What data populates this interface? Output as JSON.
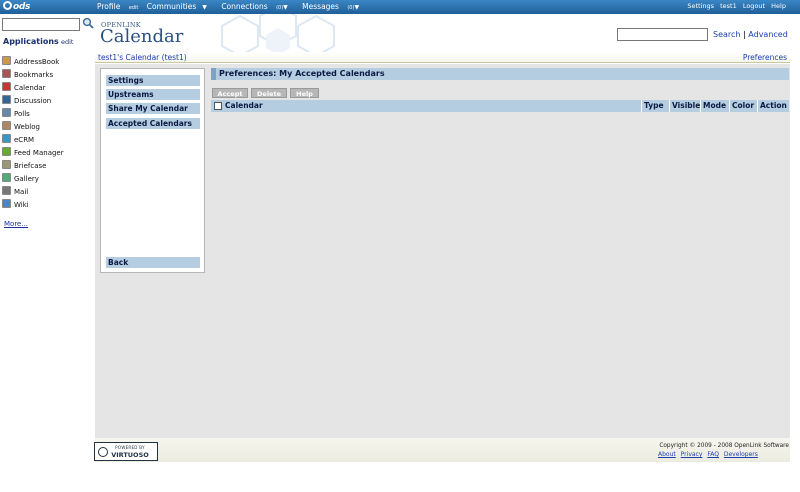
{
  "topbar": {
    "logo": "ods",
    "nav": {
      "profile": "Profile",
      "profile_edit": "edit",
      "communities": "Communities",
      "connections": "Connections",
      "connections_count": "(0)",
      "messages": "Messages",
      "messages_count": "(0)"
    },
    "right": {
      "settings": "Settings",
      "user": "test1",
      "logout": "Logout",
      "help": "Help"
    }
  },
  "left": {
    "apps_title": "Applications",
    "apps_edit": "edit",
    "apps": [
      {
        "label": "AddressBook",
        "icon": "addressbook-icon"
      },
      {
        "label": "Bookmarks",
        "icon": "bookmarks-icon"
      },
      {
        "label": "Calendar",
        "icon": "calendar-icon"
      },
      {
        "label": "Discussion",
        "icon": "discussion-icon"
      },
      {
        "label": "Polls",
        "icon": "polls-icon"
      },
      {
        "label": "Weblog",
        "icon": "weblog-icon"
      },
      {
        "label": "eCRM",
        "icon": "ecrm-icon"
      },
      {
        "label": "Feed Manager",
        "icon": "feed-icon"
      },
      {
        "label": "Briefcase",
        "icon": "briefcase-icon"
      },
      {
        "label": "Gallery",
        "icon": "gallery-icon"
      },
      {
        "label": "Mail",
        "icon": "mail-icon"
      },
      {
        "label": "Wiki",
        "icon": "wiki-icon"
      }
    ],
    "more": "More..."
  },
  "header": {
    "brand_small": "OPENLINK",
    "brand_big": "Calendar",
    "search": "Search",
    "sep": "|",
    "advanced": "Advanced"
  },
  "crumb": {
    "title": "test1's Calendar (test1)",
    "preferences": "Preferences"
  },
  "menu": {
    "items": [
      "Settings",
      "Upstreams",
      "Share My Calendar",
      "Accepted Calendars"
    ],
    "back": "Back"
  },
  "content": {
    "title": "Preferences: My Accepted Calendars",
    "buttons": {
      "accept": "Accept",
      "delete": "Delete",
      "help": "Help"
    },
    "columns": {
      "calendar": "Calendar",
      "type": "Type",
      "visible": "Visible",
      "mode": "Mode",
      "color": "Color",
      "action": "Action"
    }
  },
  "footer": {
    "badge_top": "POWERED BY",
    "badge_main": "VIRTUOSO",
    "copyright": "Copyright © 2009 - 2008 OpenLink Software",
    "links": {
      "about": "About",
      "privacy": "Privacy",
      "faq": "FAQ",
      "developers": "Developers"
    }
  }
}
